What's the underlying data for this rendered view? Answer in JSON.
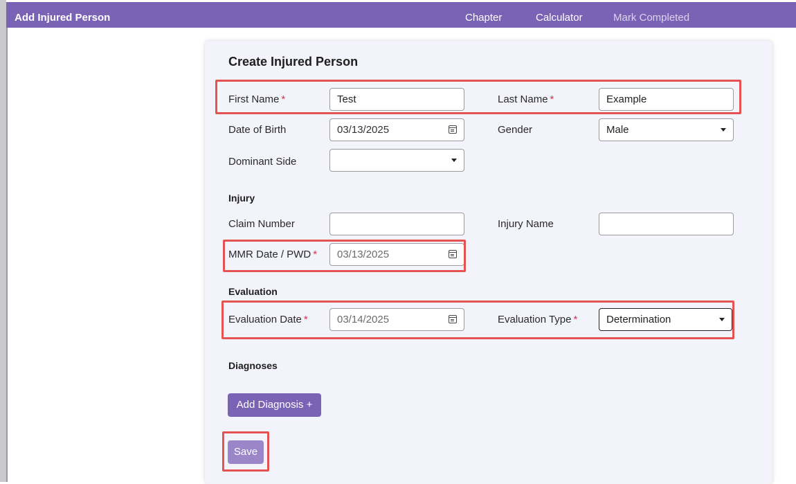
{
  "topbar": {
    "title": "Add Injured Person",
    "nav": {
      "chapter": "Chapter",
      "calculator": "Calculator",
      "mark_completed": "Mark Completed"
    }
  },
  "form": {
    "title": "Create Injured Person",
    "required_mark": "*",
    "first_name": {
      "label": "First Name",
      "value": "Test"
    },
    "last_name": {
      "label": "Last Name",
      "value": "Example"
    },
    "dob": {
      "label": "Date of Birth",
      "value": "03/13/2025"
    },
    "gender": {
      "label": "Gender",
      "value": "Male"
    },
    "dominant_side": {
      "label": "Dominant Side",
      "value": ""
    },
    "injury": {
      "title": "Injury",
      "claim_number": {
        "label": "Claim Number",
        "value": ""
      },
      "injury_name": {
        "label": "Injury Name",
        "value": ""
      },
      "mmr_date": {
        "label": "MMR Date / PWD",
        "value": "03/13/2025"
      }
    },
    "evaluation": {
      "title": "Evaluation",
      "date": {
        "label": "Evaluation Date",
        "value": "03/14/2025"
      },
      "type": {
        "label": "Evaluation Type",
        "value": "Determination"
      }
    },
    "diagnoses": {
      "title": "Diagnoses",
      "add_label": "Add Diagnosis +"
    },
    "save_label": "Save"
  },
  "colors": {
    "accent": "#7a63b5",
    "highlight": "#e45350",
    "required": "#d6334a"
  }
}
